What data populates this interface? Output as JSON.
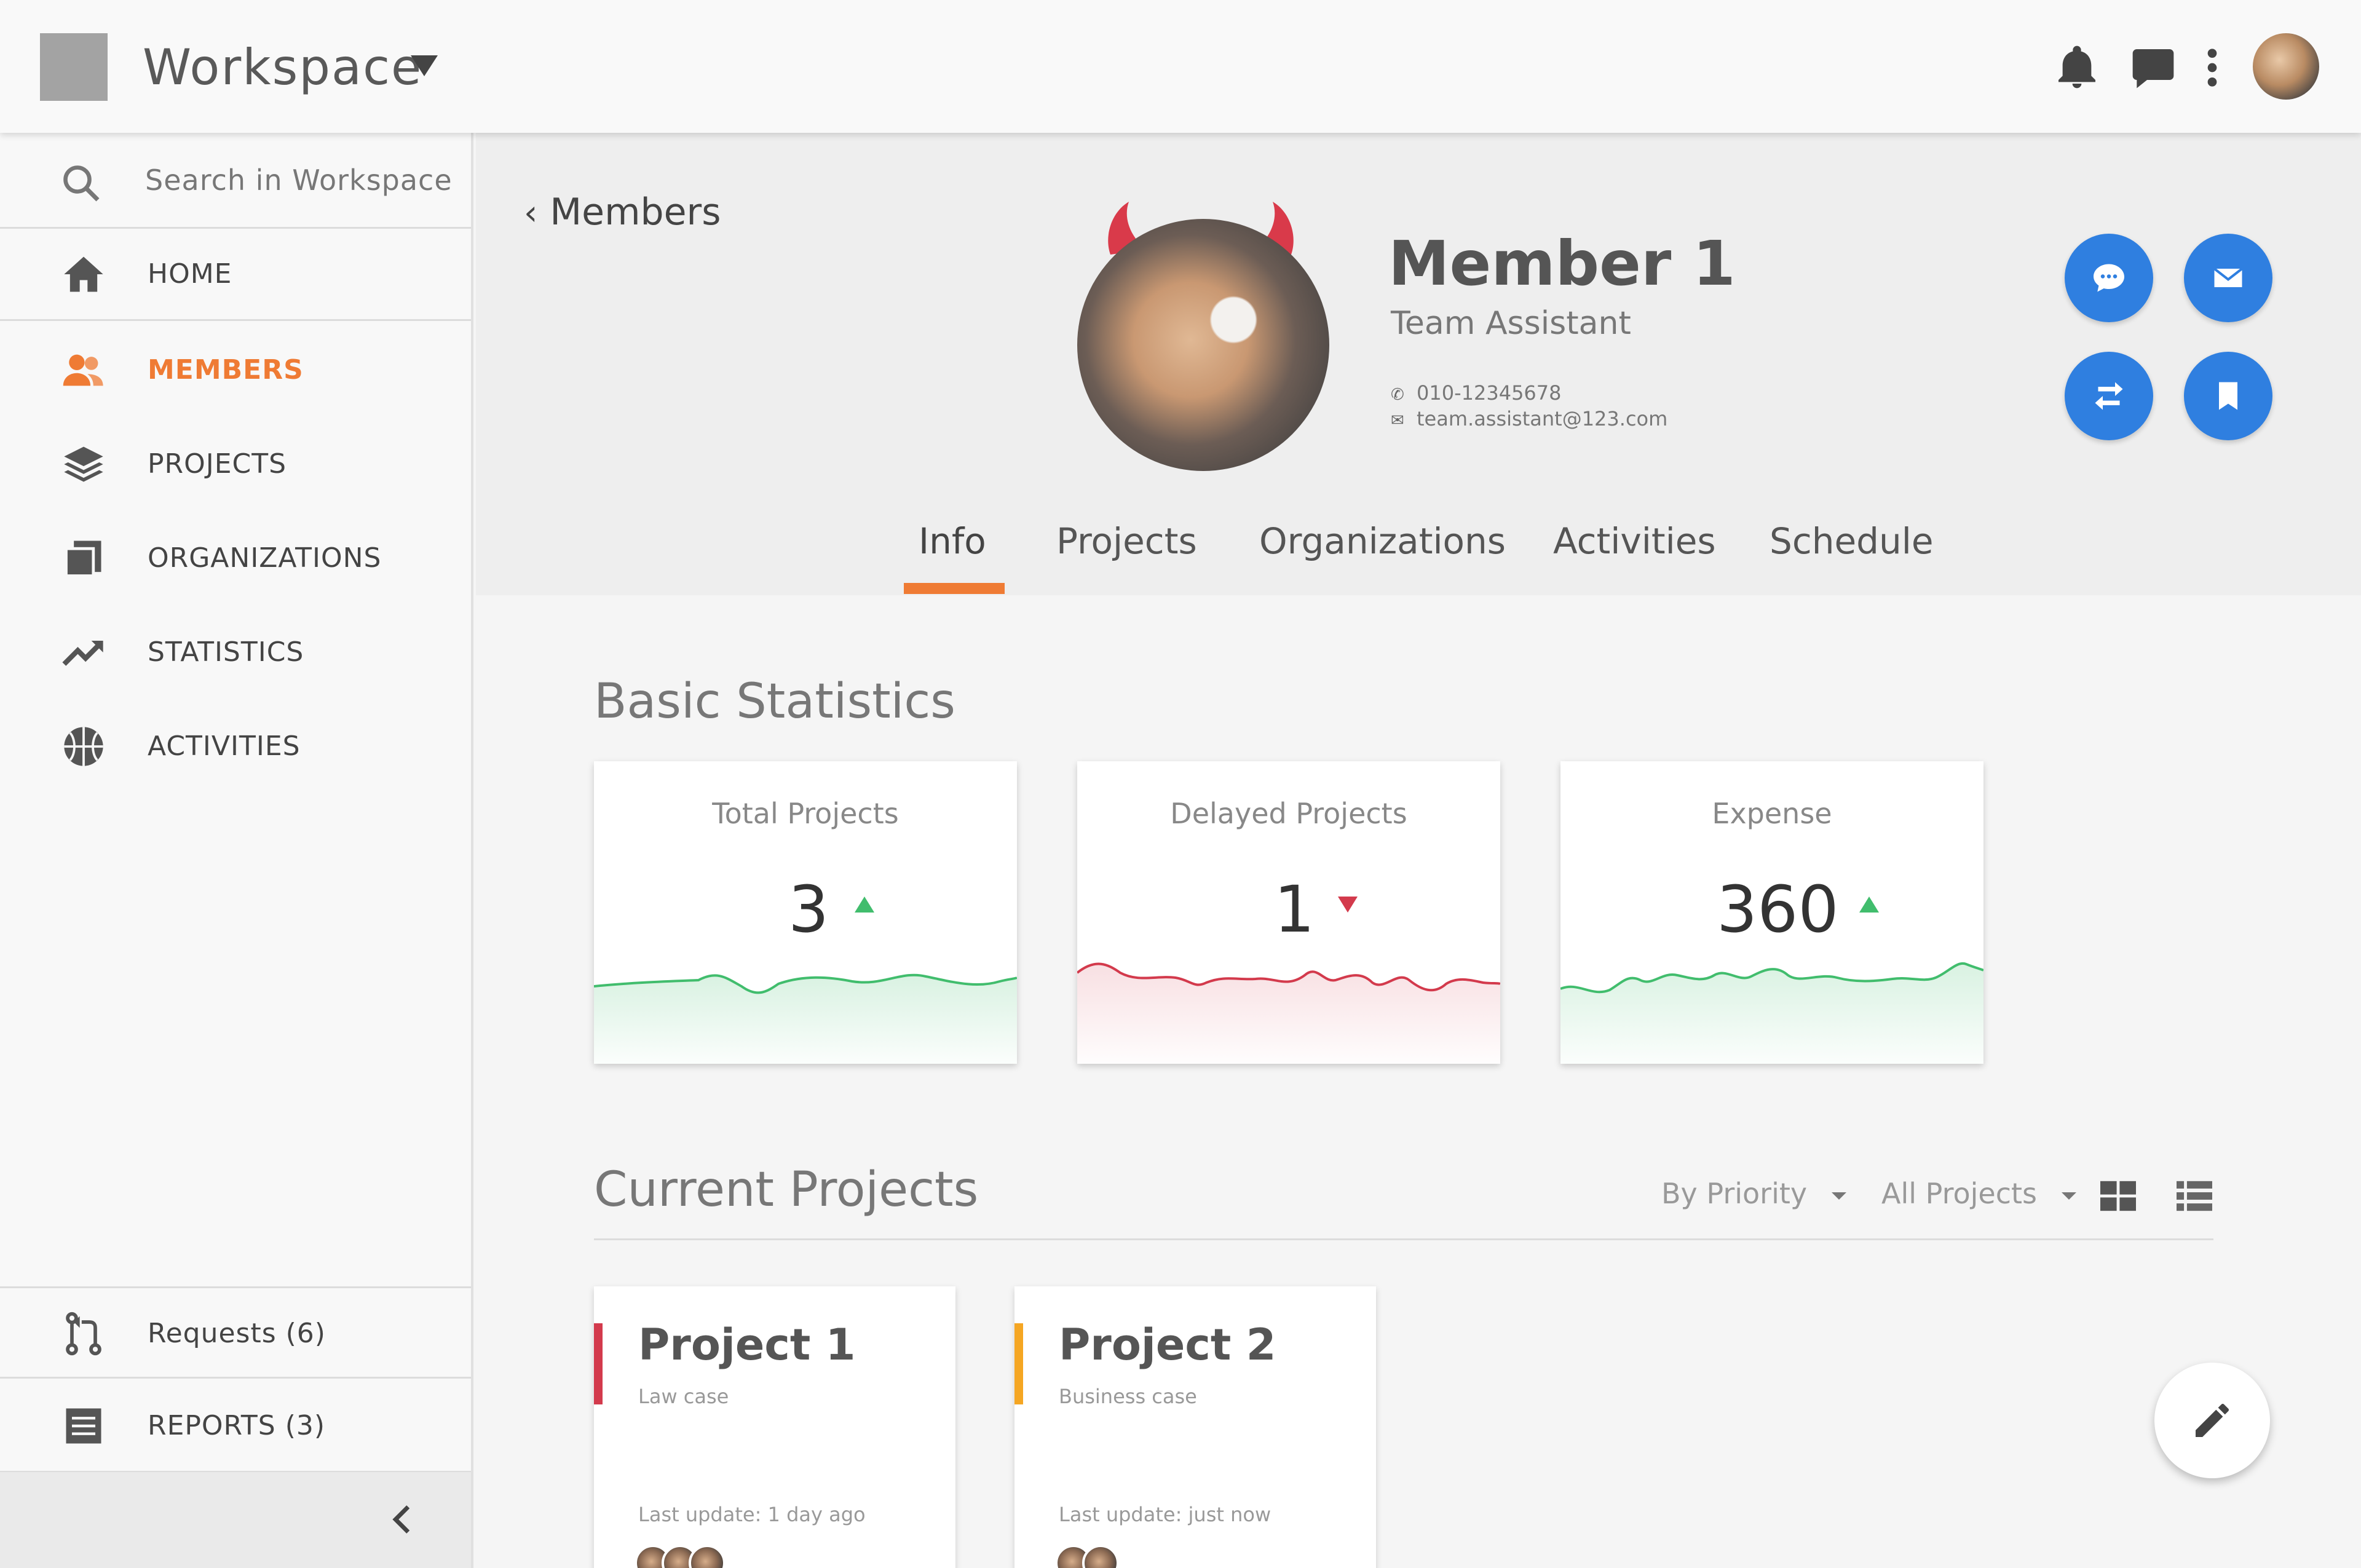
{
  "app": {
    "title": "Workspace"
  },
  "search": {
    "placeholder": "Search in Workspace"
  },
  "sidebar": {
    "items": [
      {
        "label": "HOME",
        "icon": "home-icon"
      },
      {
        "label": "MEMBERS",
        "icon": "members-icon",
        "active": true
      },
      {
        "label": "PROJECTS",
        "icon": "layers-icon"
      },
      {
        "label": "ORGANIZATIONS",
        "icon": "organizations-icon"
      },
      {
        "label": "STATISTICS",
        "icon": "trending-icon"
      },
      {
        "label": "ACTIVITIES",
        "icon": "basketball-icon"
      }
    ],
    "bottom_items": [
      {
        "label": "Requests (6)",
        "icon": "pull-request-icon"
      },
      {
        "label": "REPORTS (3)",
        "icon": "reports-icon"
      }
    ]
  },
  "profile": {
    "back_label": "Members",
    "name": "Member 1",
    "role": "Team Assistant",
    "phone": "010-12345678",
    "email": "team.assistant@123.com"
  },
  "tabs": [
    {
      "label": "Info",
      "active": true
    },
    {
      "label": "Projects"
    },
    {
      "label": "Organizations"
    },
    {
      "label": "Activities"
    },
    {
      "label": "Schedule"
    }
  ],
  "basic_statistics": {
    "title": "Basic Statistics",
    "cards": [
      {
        "label": "Total Projects",
        "value": "3",
        "trend": "up",
        "color": "#41bd6d"
      },
      {
        "label": "Delayed Projects",
        "value": "1",
        "trend": "down",
        "color": "#d33a4c"
      },
      {
        "label": "Expense",
        "value": "360",
        "trend": "up",
        "color": "#41bd6d"
      }
    ]
  },
  "current_projects": {
    "title": "Current Projects",
    "filters": {
      "sort": "By Priority",
      "scope": "All Projects"
    },
    "projects": [
      {
        "name": "Project 1",
        "type": "Law case",
        "update": "Last update: 1 day ago",
        "color": "#d33a4c"
      },
      {
        "name": "Project 2",
        "type": "Business case",
        "update": "Last update: just now",
        "color": "#f5a623"
      }
    ]
  },
  "colors": {
    "accent": "#ef7b34",
    "primary_blue": "#2f7fe0"
  }
}
